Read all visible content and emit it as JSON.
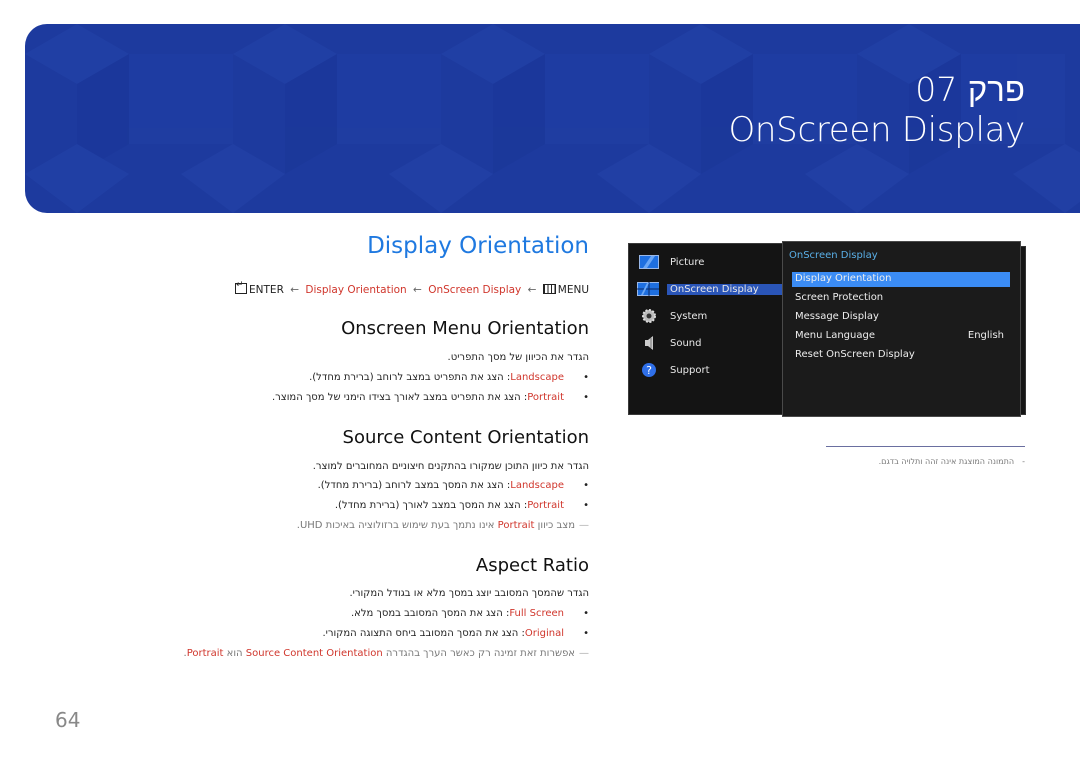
{
  "banner": {
    "chapter": "פרק 07",
    "title": "OnScreen Display",
    "color": "#1d3a9e"
  },
  "section": {
    "title": "Display Orientation",
    "path": {
      "enter": "ENTER",
      "item1": "Display Orientation",
      "item2": "OnScreen Display",
      "menu": "MENU",
      "arrow": "←"
    }
  },
  "onscreen_menu_orientation": {
    "heading": "Onscreen Menu Orientation",
    "desc": "הגדר את הכיוון של מסך התפריט.",
    "items": [
      {
        "keyword": "Landscape",
        "text": ": הצג את התפריט במצב לרוחב (ברירת מחדל)."
      },
      {
        "keyword": "Portrait",
        "text": ": הצג את התפריט במצב לאורך בצידו הימני של מסך המוצר."
      }
    ]
  },
  "source_content_orientation": {
    "heading": "Source Content Orientation",
    "desc": "הגדר את כיוון התוכן שמקורו בהתקנים חיצוניים המחוברים למוצר.",
    "items": [
      {
        "keyword": "Landscape",
        "text": ": הצג את המסך במצב לרוחב (ברירת מחדל)."
      },
      {
        "keyword": "Portrait",
        "text": ": הצג את המסך במצב לאורך (ברירת מחדל)."
      }
    ],
    "note": {
      "pre": "מצב כיוון ",
      "keyword": "Portrait",
      "post": " אינו נתמך בעת שימוש ברזולוציה באיכות UHD."
    }
  },
  "aspect_ratio": {
    "heading": "Aspect Ratio",
    "desc": "הגדר שהמסך המסובב יוצג במסך מלא או בגודל המקורי.",
    "items": [
      {
        "keyword": "Full Screen",
        "text": ": הצג את המסך המסובב במסך מלא."
      },
      {
        "keyword": "Original",
        "text": ": הצג את המסך המסובב ביחס התצוגה המקורי."
      }
    ],
    "note": {
      "pre": "אפשרות זאת זמינה רק כאשר הערך בהגדרה ",
      "keyword": "Source Content Orientation",
      "mid": " הוא ",
      "keyword2": "Portrait",
      "post": "."
    }
  },
  "osd": {
    "main_menu": [
      {
        "label": "Picture",
        "icon": "picture-icon"
      },
      {
        "label": "OnScreen Display",
        "icon": "onscreen-display-icon",
        "active": true
      },
      {
        "label": "System",
        "icon": "gear-icon"
      },
      {
        "label": "Sound",
        "icon": "speaker-icon"
      },
      {
        "label": "Support",
        "icon": "question-icon"
      }
    ],
    "submenu_title": "OnScreen Display",
    "submenu": [
      {
        "label": "Display Orientation",
        "value": "",
        "active": true
      },
      {
        "label": "Screen Protection",
        "value": ""
      },
      {
        "label": "Message Display",
        "value": ""
      },
      {
        "label": "Menu Language",
        "value": "English"
      },
      {
        "label": "Reset OnScreen Display",
        "value": ""
      }
    ]
  },
  "disclaimer": "התמונה המוצגת אינה זהה ותלויה בדגם.",
  "disclaimer_dash": "-",
  "page_number": "64",
  "colors": {
    "heading_blue": "#1f79e0",
    "keyword_red": "#d0362c",
    "osd_highlight": "#3b8cf5"
  }
}
